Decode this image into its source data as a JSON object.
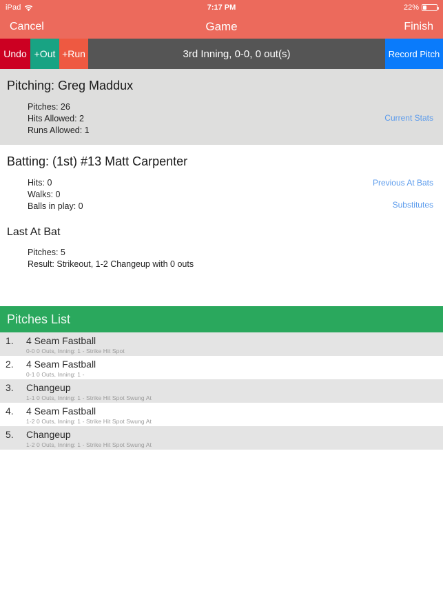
{
  "status_bar": {
    "device": "iPad",
    "wifi_icon": "wifi-icon",
    "time": "7:17 PM",
    "battery_percent": "22%",
    "battery_level": 22
  },
  "nav_bar": {
    "cancel_label": "Cancel",
    "title": "Game",
    "finish_label": "Finish"
  },
  "action_bar": {
    "undo_label": "Undo",
    "out_label": "+Out",
    "run_label": "+Run",
    "status_text": "3rd Inning, 0-0, 0 out(s)",
    "record_pitch_label": "Record Pitch"
  },
  "pitching": {
    "title": "Pitching: Greg Maddux",
    "stats": [
      "Pitches: 26",
      "Hits Allowed: 2",
      "Runs Allowed: 1"
    ],
    "current_stats_link": "Current Stats"
  },
  "batting": {
    "title": "Batting: (1st) #13 Matt Carpenter",
    "stats": [
      "Hits: 0",
      "Walks: 0",
      "Balls in play: 0"
    ],
    "previous_at_bats_link": "Previous At Bats",
    "substitutes_link": "Substitutes",
    "last_at_bat_title": "Last At Bat",
    "last_at_bat_stats": [
      "Pitches: 5",
      "Result: Strikeout, 1-2 Changeup with 0 outs"
    ]
  },
  "pitches_list": {
    "header": "Pitches List",
    "rows": [
      {
        "index": "1.",
        "name": "4 Seam Fastball",
        "detail": "0-0 0 Outs, Inning: 1 -  Strike  Hit Spot"
      },
      {
        "index": "2.",
        "name": "4 Seam Fastball",
        "detail": "0-1 0 Outs, Inning: 1 -"
      },
      {
        "index": "3.",
        "name": "Changeup",
        "detail": "1-1 0 Outs, Inning: 1 -  Strike  Hit Spot  Swung At"
      },
      {
        "index": "4.",
        "name": "4 Seam Fastball",
        "detail": "1-2 0 Outs, Inning: 1 -  Strike  Hit Spot  Swung At"
      },
      {
        "index": "5.",
        "name": "Changeup",
        "detail": "1-2 0 Outs, Inning: 1 -  Strike  Hit Spot  Swung At"
      }
    ]
  },
  "colors": {
    "nav_red": "#ec6a5c",
    "undo_red": "#cc0022",
    "out_green": "#18a383",
    "run_orange": "#ee5941",
    "status_gray": "#555555",
    "record_blue": "#0a7bfb",
    "list_green": "#2aa85d",
    "link_blue": "#5b9bec",
    "section_gray": "#dededd"
  }
}
